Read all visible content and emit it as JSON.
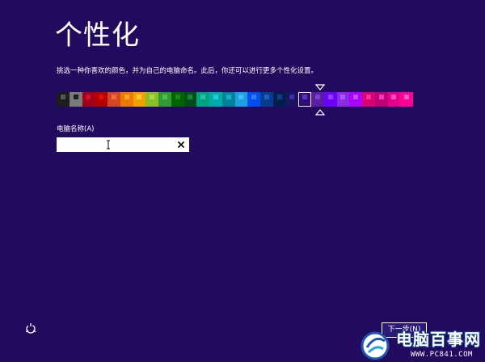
{
  "page": {
    "title": "个性化",
    "description": "挑选一种你喜欢的颜色，并为自己的电脑命名。此后，你还可以进行更多个性化设置。"
  },
  "palette": {
    "selected_index": 19,
    "swatches": [
      {
        "bg": "#1d1d1d",
        "tile": "#555555"
      },
      {
        "bg": "#7a7a7a",
        "tile": "#1d1d1d"
      },
      {
        "bg": "#a0001c",
        "tile": "#d1102e"
      },
      {
        "bg": "#b50000",
        "tile": "#e01010"
      },
      {
        "bg": "#d24726",
        "tile": "#f06a3a"
      },
      {
        "bg": "#e87b00",
        "tile": "#ffa030"
      },
      {
        "bg": "#f0a300",
        "tile": "#ffc840"
      },
      {
        "bg": "#8cbf26",
        "tile": "#a8d84a"
      },
      {
        "bg": "#339933",
        "tile": "#4fbf4f"
      },
      {
        "bg": "#006400",
        "tile": "#138a13"
      },
      {
        "bg": "#004d1a",
        "tile": "#0c8a2e"
      },
      {
        "bg": "#00a381",
        "tile": "#20c4a0"
      },
      {
        "bg": "#00aba9",
        "tile": "#1fd0cc"
      },
      {
        "bg": "#008299",
        "tile": "#12b0c8"
      },
      {
        "bg": "#1ba1e2",
        "tile": "#46baf2"
      },
      {
        "bg": "#0050ef",
        "tile": "#3478ff"
      },
      {
        "bg": "#0a3a8c",
        "tile": "#1e5ec4"
      },
      {
        "bg": "#001e4e",
        "tile": "#0c3f8c"
      },
      {
        "bg": "#1b1464",
        "tile": "#3a2ea0"
      },
      {
        "bg": "#2e0f7a",
        "tile": "#5b32c0"
      },
      {
        "bg": "#5a1ea0",
        "tile": "#7d3fd0"
      },
      {
        "bg": "#6a00ff",
        "tile": "#9040ff"
      },
      {
        "bg": "#8a2be2",
        "tile": "#aa55ff"
      },
      {
        "bg": "#aa00ff",
        "tile": "#c44bff"
      },
      {
        "bg": "#d80073",
        "tile": "#f5339a"
      },
      {
        "bg": "#c00078",
        "tile": "#ef3ea5"
      },
      {
        "bg": "#e3008c",
        "tile": "#ff4fb8"
      },
      {
        "bg": "#ff0097",
        "tile": "#ff5abf"
      }
    ]
  },
  "name_field": {
    "label": "电脑名称(A)",
    "value": "",
    "clear_icon": "close-icon"
  },
  "footer": {
    "ease_of_access_icon": "ease-of-access-icon",
    "next_label": "下一步(N)"
  },
  "watermark": {
    "title": "电脑百事网",
    "url": "WWW.PC841.COM"
  },
  "colors": {
    "background": "#220a5e",
    "text": "#ffffff",
    "accent": "#5b32c0"
  }
}
